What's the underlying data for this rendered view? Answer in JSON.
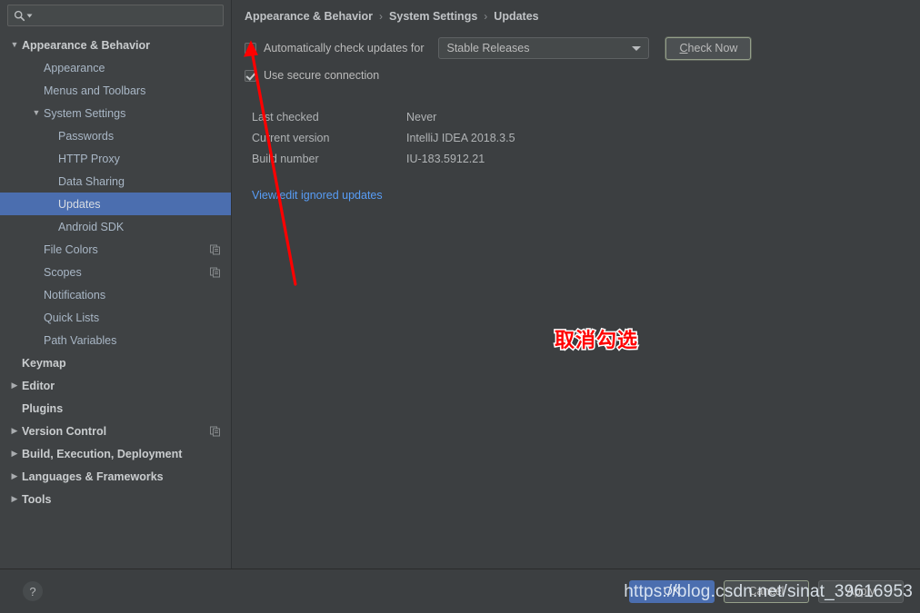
{
  "search": {
    "placeholder": "",
    "value": "",
    "icon": "search-icon"
  },
  "sidebar": {
    "items": [
      {
        "label": "Appearance & Behavior",
        "level": 0,
        "twisty": "▼",
        "bold": true,
        "selected": false,
        "copy": false
      },
      {
        "label": "Appearance",
        "level": 1,
        "twisty": "",
        "bold": false,
        "selected": false,
        "copy": false
      },
      {
        "label": "Menus and Toolbars",
        "level": 1,
        "twisty": "",
        "bold": false,
        "selected": false,
        "copy": false
      },
      {
        "label": "System Settings",
        "level": 1,
        "twisty": "▼",
        "bold": false,
        "selected": false,
        "copy": false
      },
      {
        "label": "Passwords",
        "level": 2,
        "twisty": "",
        "bold": false,
        "selected": false,
        "copy": false
      },
      {
        "label": "HTTP Proxy",
        "level": 2,
        "twisty": "",
        "bold": false,
        "selected": false,
        "copy": false
      },
      {
        "label": "Data Sharing",
        "level": 2,
        "twisty": "",
        "bold": false,
        "selected": false,
        "copy": false
      },
      {
        "label": "Updates",
        "level": 2,
        "twisty": "",
        "bold": false,
        "selected": true,
        "copy": false
      },
      {
        "label": "Android SDK",
        "level": 2,
        "twisty": "",
        "bold": false,
        "selected": false,
        "copy": false
      },
      {
        "label": "File Colors",
        "level": 1,
        "twisty": "",
        "bold": false,
        "selected": false,
        "copy": true
      },
      {
        "label": "Scopes",
        "level": 1,
        "twisty": "",
        "bold": false,
        "selected": false,
        "copy": true
      },
      {
        "label": "Notifications",
        "level": 1,
        "twisty": "",
        "bold": false,
        "selected": false,
        "copy": false
      },
      {
        "label": "Quick Lists",
        "level": 1,
        "twisty": "",
        "bold": false,
        "selected": false,
        "copy": false
      },
      {
        "label": "Path Variables",
        "level": 1,
        "twisty": "",
        "bold": false,
        "selected": false,
        "copy": false
      },
      {
        "label": "Keymap",
        "level": 0,
        "twisty": "",
        "bold": true,
        "selected": false,
        "copy": false
      },
      {
        "label": "Editor",
        "level": 0,
        "twisty": "▶",
        "bold": true,
        "selected": false,
        "copy": false
      },
      {
        "label": "Plugins",
        "level": 0,
        "twisty": "",
        "bold": true,
        "selected": false,
        "copy": false
      },
      {
        "label": "Version Control",
        "level": 0,
        "twisty": "▶",
        "bold": true,
        "selected": false,
        "copy": true
      },
      {
        "label": "Build, Execution, Deployment",
        "level": 0,
        "twisty": "▶",
        "bold": true,
        "selected": false,
        "copy": false
      },
      {
        "label": "Languages & Frameworks",
        "level": 0,
        "twisty": "▶",
        "bold": true,
        "selected": false,
        "copy": false
      },
      {
        "label": "Tools",
        "level": 0,
        "twisty": "▶",
        "bold": true,
        "selected": false,
        "copy": false
      }
    ]
  },
  "breadcrumb": {
    "items": [
      "Appearance & Behavior",
      "System Settings",
      "Updates"
    ],
    "separator": "›"
  },
  "updates": {
    "auto_check_label": "Automatically check updates for",
    "auto_check_checked": false,
    "channel_selected": "Stable Releases",
    "check_now_mnemonic": "C",
    "check_now_rest": "heck Now",
    "secure_connection_label": "Use secure connection",
    "secure_connection_checked": true,
    "info": [
      {
        "key": "Last checked",
        "value": "Never"
      },
      {
        "key": "Current version",
        "value": "IntelliJ IDEA 2018.3.5"
      },
      {
        "key": "Build number",
        "value": "IU-183.5912.21"
      }
    ],
    "ignored_updates_link": "View/edit ignored updates"
  },
  "annotation": {
    "text": "取消勾选",
    "color": "#ff0000",
    "outline_color": "#ffffff"
  },
  "footer": {
    "help_glyph": "?",
    "buttons": [
      {
        "label": "OK",
        "style": "primary"
      },
      {
        "label": "Cancel",
        "style": "default"
      },
      {
        "label": "Apply",
        "style": "default"
      }
    ]
  },
  "watermark": {
    "text": "https://blog.csdn.net/sinat_39616953"
  },
  "colors": {
    "accent": "#4b6eaf",
    "link": "#589df6",
    "background": "#3c3f41",
    "sidebar": "#3f4244",
    "annotation": "#ff0000"
  }
}
